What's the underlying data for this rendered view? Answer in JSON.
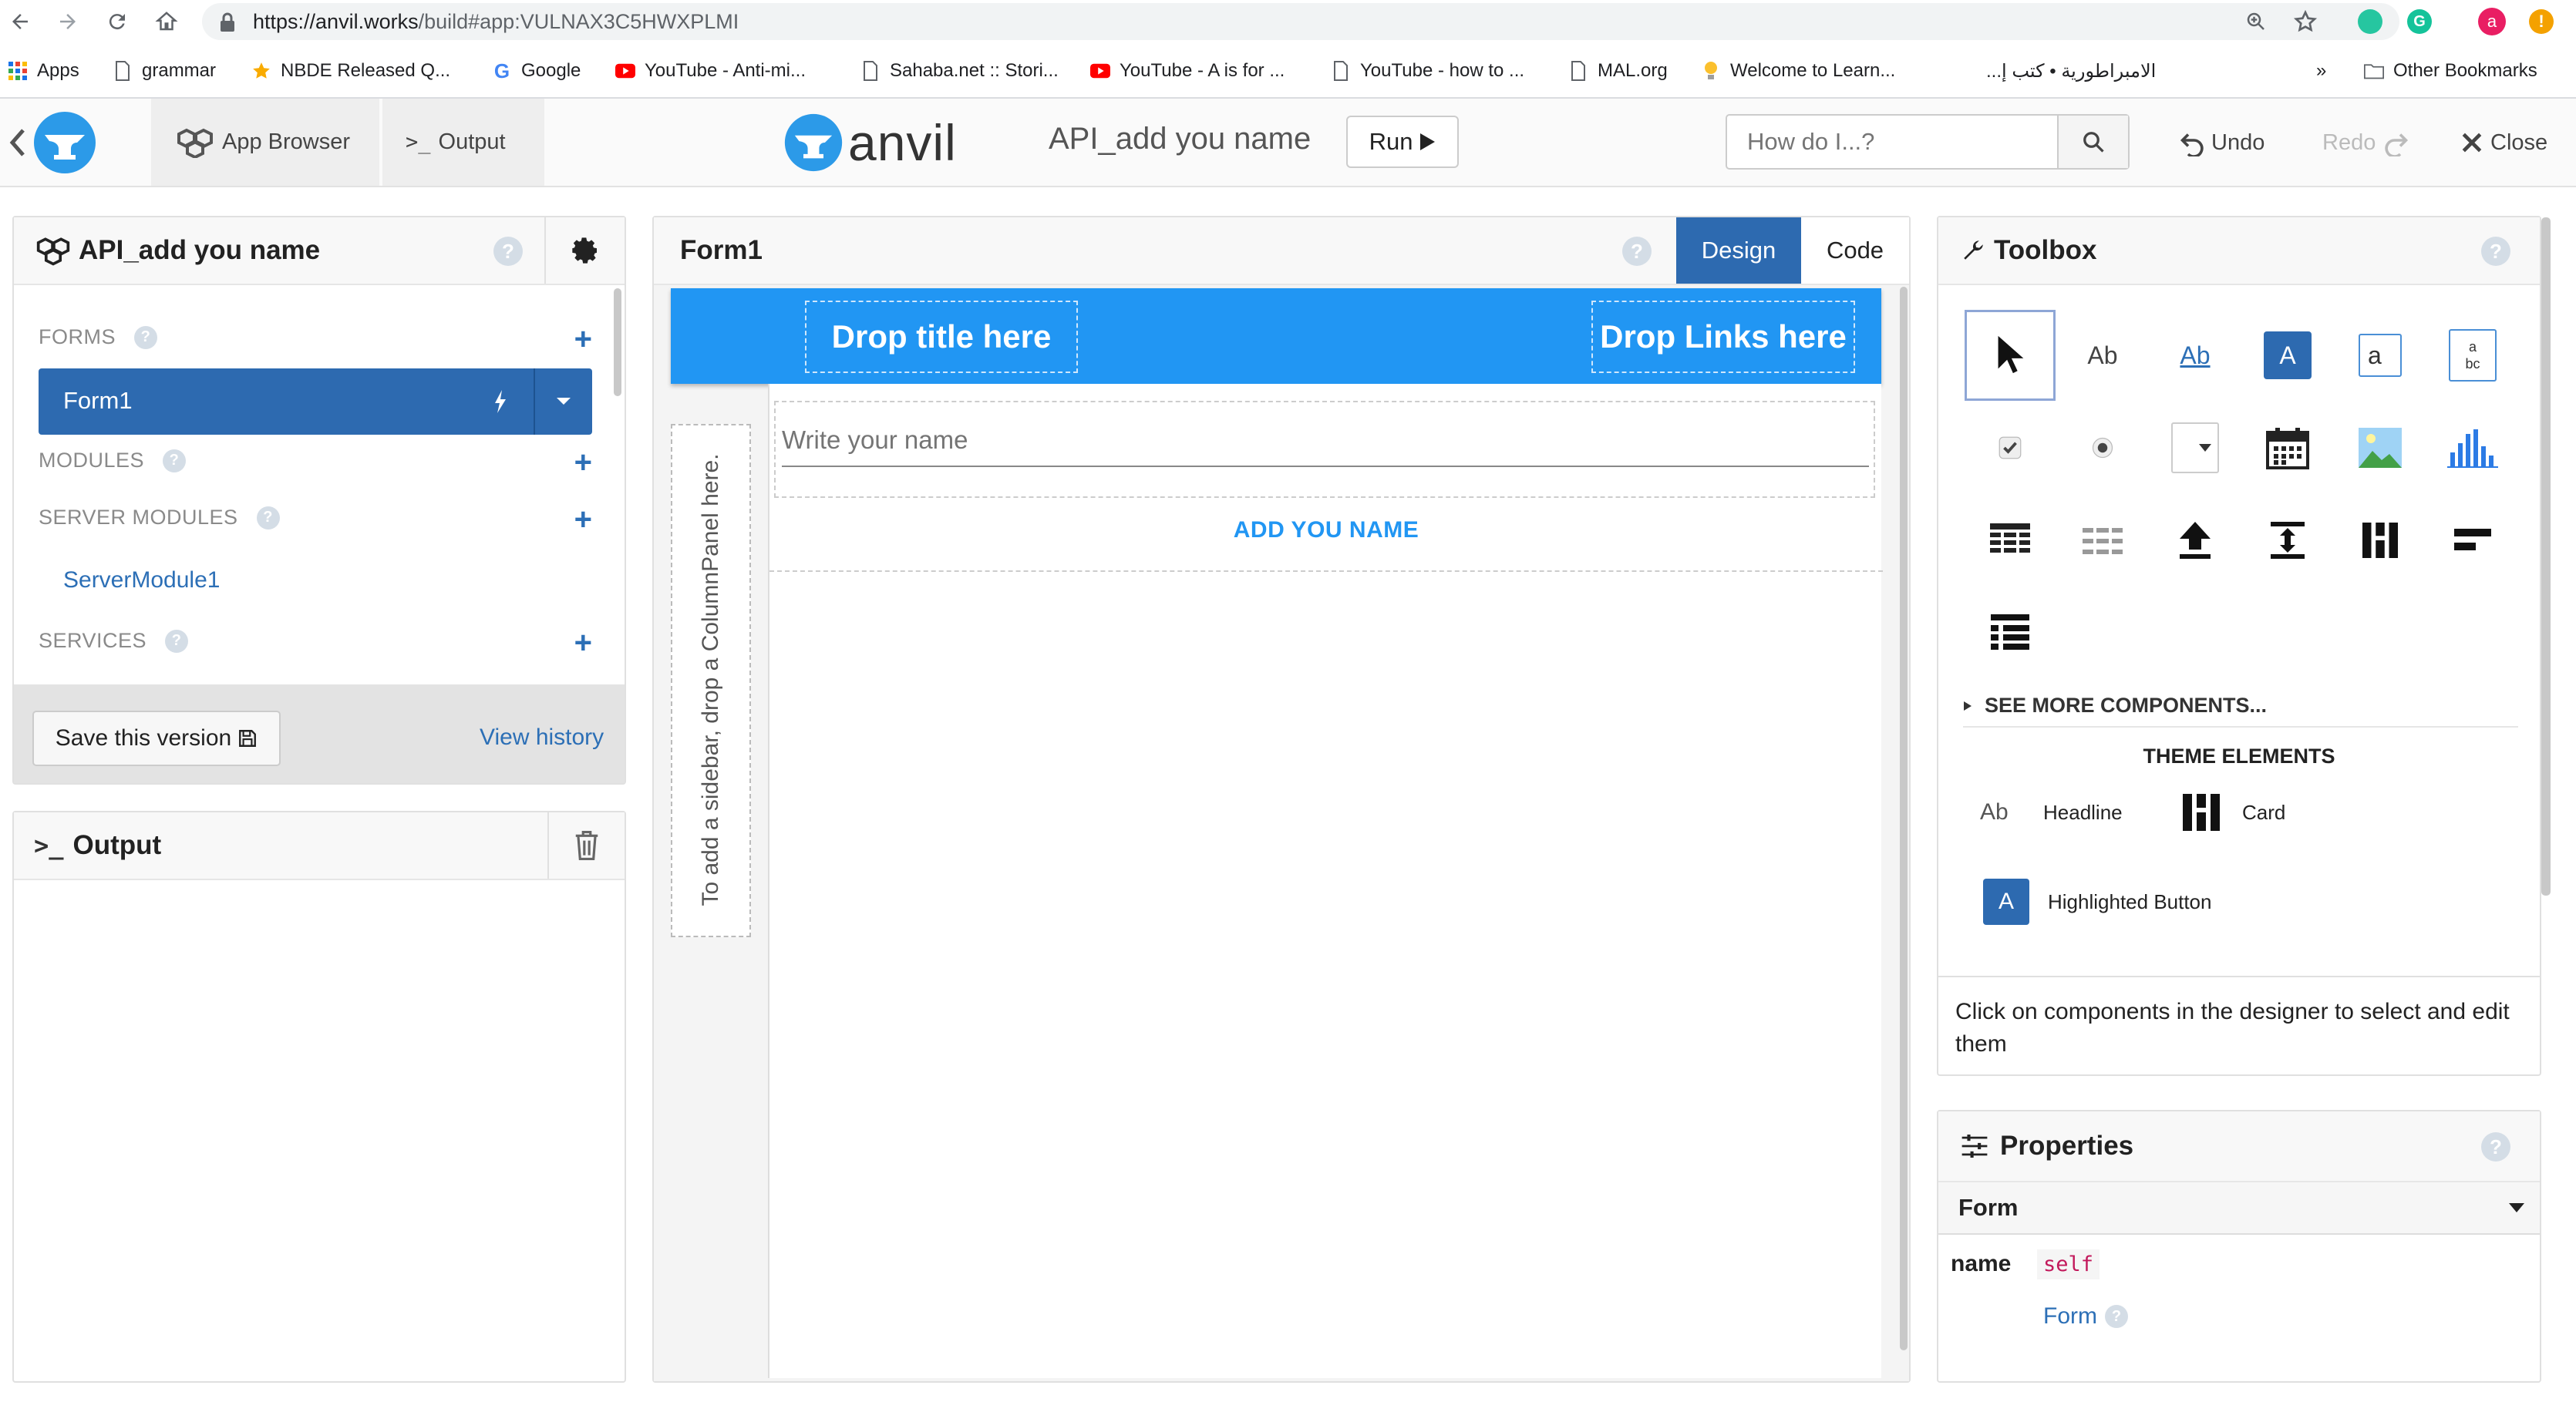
{
  "browser": {
    "url_host": "https://anvil.works",
    "url_path": "/build#app:VULNAX3C5HWXPLMI",
    "bookmarks": [
      {
        "label": "Apps",
        "icon": "apps-grid-icon"
      },
      {
        "label": "grammar",
        "icon": "page-icon"
      },
      {
        "label": "NBDE Released Q...",
        "icon": "star-icon"
      },
      {
        "label": "Google",
        "icon": "google-icon"
      },
      {
        "label": "YouTube - Anti-mi...",
        "icon": "youtube-icon"
      },
      {
        "label": "Sahaba.net :: Stori...",
        "icon": "page-icon"
      },
      {
        "label": "YouTube - A is for ...",
        "icon": "youtube-icon"
      },
      {
        "label": "YouTube - how to ...",
        "icon": "page-icon"
      },
      {
        "label": "MAL.org",
        "icon": "page-icon"
      },
      {
        "label": "Welcome to Learn...",
        "icon": "bulb-icon"
      },
      {
        "label": "الامبراطورية • كتب إ...",
        "icon": "page-icon"
      }
    ],
    "overflow_label": "»",
    "other_bookmarks": "Other Bookmarks",
    "profile_initial": "a",
    "alert_symbol": "!"
  },
  "topbar": {
    "app_browser": "App Browser",
    "output_tab": "Output",
    "logo_text": "anvil",
    "app_name": "API_add you name",
    "run_label": "Run",
    "search_placeholder": "How do I...?",
    "undo": "Undo",
    "redo": "Redo",
    "close": "Close"
  },
  "app_panel": {
    "title": "API_add you name",
    "help": "?",
    "forms_label": "FORMS",
    "form_item": "Form1",
    "modules_label": "MODULES",
    "server_modules_label": "SERVER MODULES",
    "server_module_item": "ServerModule1",
    "services_label": "SERVICES",
    "save_button": "Save this version",
    "view_history": "View history"
  },
  "output_panel": {
    "title": "Output"
  },
  "designer": {
    "title": "Form1",
    "design_tab": "Design",
    "code_tab": "Code",
    "drop_title": "Drop title here",
    "drop_links": "Drop Links here",
    "sidebar_hint": "To add a sidebar, drop a ColumnPanel here.",
    "name_placeholder": "Write your name",
    "add_button": "ADD YOU NAME",
    "accent_color": "#2196f3"
  },
  "toolbox": {
    "title": "Toolbox",
    "label_sample": "Ab",
    "link_sample": "Ab",
    "button_sample": "A",
    "textbox_sample": "a",
    "textarea_sample_top": "a",
    "textarea_sample_bottom": "bc",
    "see_more": "SEE MORE COMPONENTS...",
    "theme_heading": "THEME ELEMENTS",
    "theme_items": [
      {
        "icon_text": "Ab",
        "label": "Headline"
      },
      {
        "icon_text": "",
        "label": "Card"
      },
      {
        "icon_text": "A",
        "label": "Highlighted Button"
      }
    ],
    "hint": "Click on components in the designer to select and edit them"
  },
  "properties": {
    "title": "Properties",
    "section": "Form",
    "name_label": "name",
    "name_value": "self",
    "type_link": "Form"
  }
}
